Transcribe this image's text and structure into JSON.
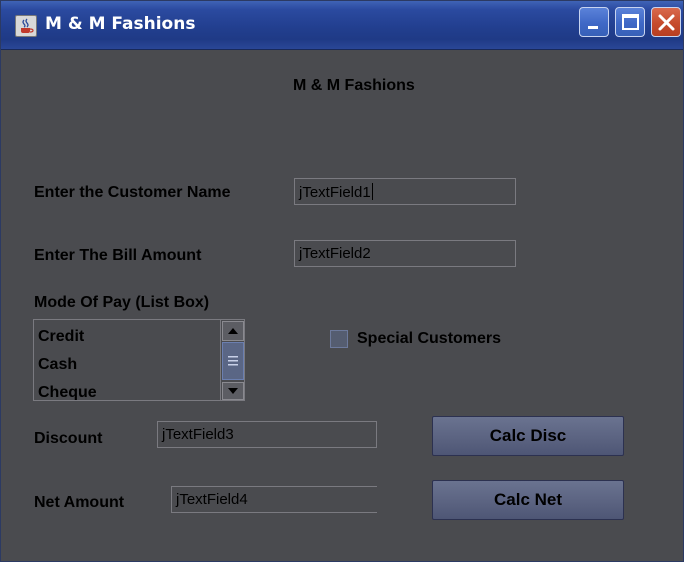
{
  "window": {
    "title": "M & M Fashions",
    "icon": "java-coffee-cup-icon",
    "controls": [
      "minimize-icon",
      "maximize-icon",
      "close-icon"
    ]
  },
  "form": {
    "heading": "M & M Fashions",
    "customer_name": {
      "label": "Enter the Customer Name",
      "value": "jTextField1"
    },
    "bill_amount": {
      "label": "Enter The Bill Amount",
      "value": "jTextField2"
    },
    "mode_of_pay": {
      "label": "Mode Of Pay (List Box)",
      "options": [
        "Credit",
        "Cash",
        "Cheque"
      ]
    },
    "special_customers": {
      "label": "Special Customers",
      "checked": false
    },
    "discount": {
      "label": "Discount",
      "value": "jTextField3"
    },
    "net_amount": {
      "label": "Net Amount",
      "value": "jTextField4"
    },
    "calc_disc_label": "Calc Disc",
    "calc_net_label": "Calc Net"
  },
  "colors": {
    "titlebar": "#2b4aa0",
    "content_bg": "#4a4b4f",
    "close_button": "#c64b2c"
  }
}
